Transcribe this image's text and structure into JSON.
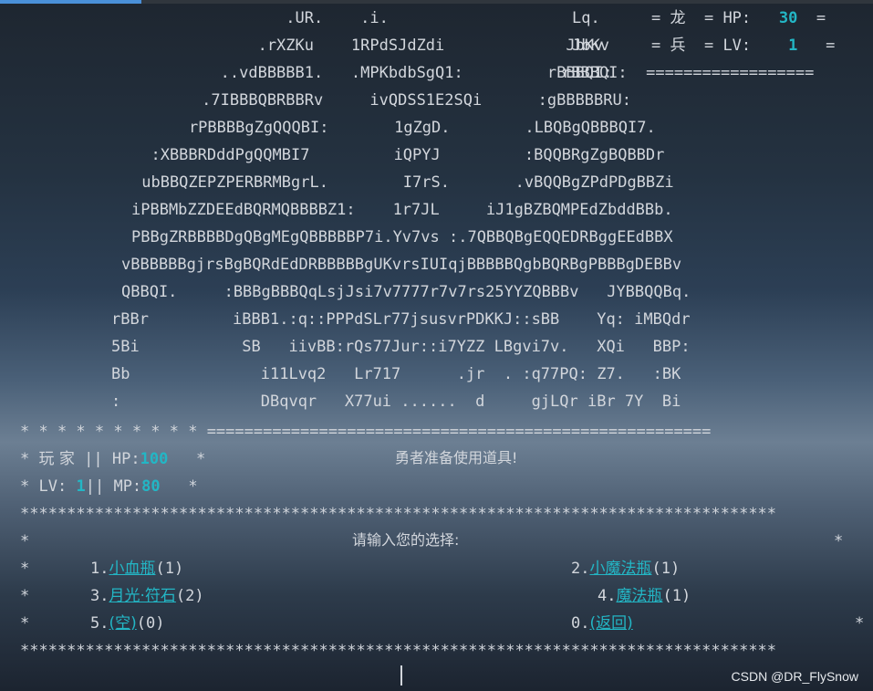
{
  "art": [
    "              .UR.    .i.",
    "           .rXZKu    1RPdSJdZdi             JbKv",
    "       ..vdBBBBB1.   .MPKbdbSgQ1:         rBBBQI:",
    "     .7IBBBQBRBBRv     ivQDSS1E2SQi      :gBBBBBRU:",
    "    rPBBBBgZgQQQBI:       1gZgD.        .LBQBgQBBBQI7.",
    "  :XBBBRDddPgQQMBI7         iQPYJ         :BQQBRgZgBQBBDr",
    " ubBBQZEPZPERBRMBgrL.        I7rS.       .vBQQBgZPdPDgBBZi",
    "iPBBMbZZDEEdBQRMQBBBBZ1:    1r7JL     iJ1gBZBQMPEdZbddBBb.",
    "PBBgZRBBBBDgQBgMEgQBBBBBP7i.Yv7vs :.7QBBQBgEQQEDRBggEEdBBX",
    "vBBBBBBgjrsBgBQRdEdDRBBBBBgUKvrsIUIqjBBBBBQgbBQRBgPBBBgDEBBv",
    "QBBQI.     :BBBgBBBQqLsjJsi7v7777r7v7rs25YYZQBBBv   JYBBQQBq.",
    "rBBr         iBBB1.:q::PPPdSLr77jsusvrPDKKJ::sBB    Yq: iMBQdr",
    "5Bi           SB   iivBB:rQs77Jur::i7YZZ LBgvi7v.   XQi   BBP:",
    "Bb              i11Lvq2   Lr717      .jr  . :q77PQ: Z7.   :BK",
    ":               DBqvqr   X77ui ......  d     gjLQr iBr 7Y  Bi"
  ],
  "hud": {
    "row1_name": "Lq.",
    "row1_sym": "龙",
    "hp_label": "HP:",
    "hp_value": "30",
    "row2_name": "JbKv",
    "row2_sym": "兵",
    "lv_label": "LV:",
    "lv_value": "1",
    "row3_name": "rBBBQI:",
    "rule": "==================",
    "row4_name": ":gBBBBBRU:",
    "row5_name": ".LBQBgQBBBQI7."
  },
  "divider_top": "* * * * * * * * * * ======================================================",
  "player": {
    "stars": "*",
    "label": "玩 家",
    "sep": "||",
    "hp_label": "HP:",
    "hp_value": "100",
    "lv_label": "LV:",
    "lv_value": "1",
    "mp_label": "MP:",
    "mp_value": "80"
  },
  "status_message": "勇者准备使用道具!",
  "border_line": "*********************************************************************************",
  "menu": {
    "prompt": "请输入您的选择:",
    "items": [
      {
        "num": "1.",
        "name": "小血瓶",
        "count": "(1)"
      },
      {
        "num": "2.",
        "name": "小魔法瓶",
        "count": "(1)"
      },
      {
        "num": "3.",
        "name": "月光·符石",
        "count": "(2)"
      },
      {
        "num": "4.",
        "name": "魔法瓶",
        "count": "(1)"
      },
      {
        "num": "5.",
        "name": "(空)",
        "count": "(0)"
      },
      {
        "num": "0.",
        "name": "(返回)",
        "count": ""
      }
    ]
  },
  "watermark": "CSDN @DR_FlySnow"
}
